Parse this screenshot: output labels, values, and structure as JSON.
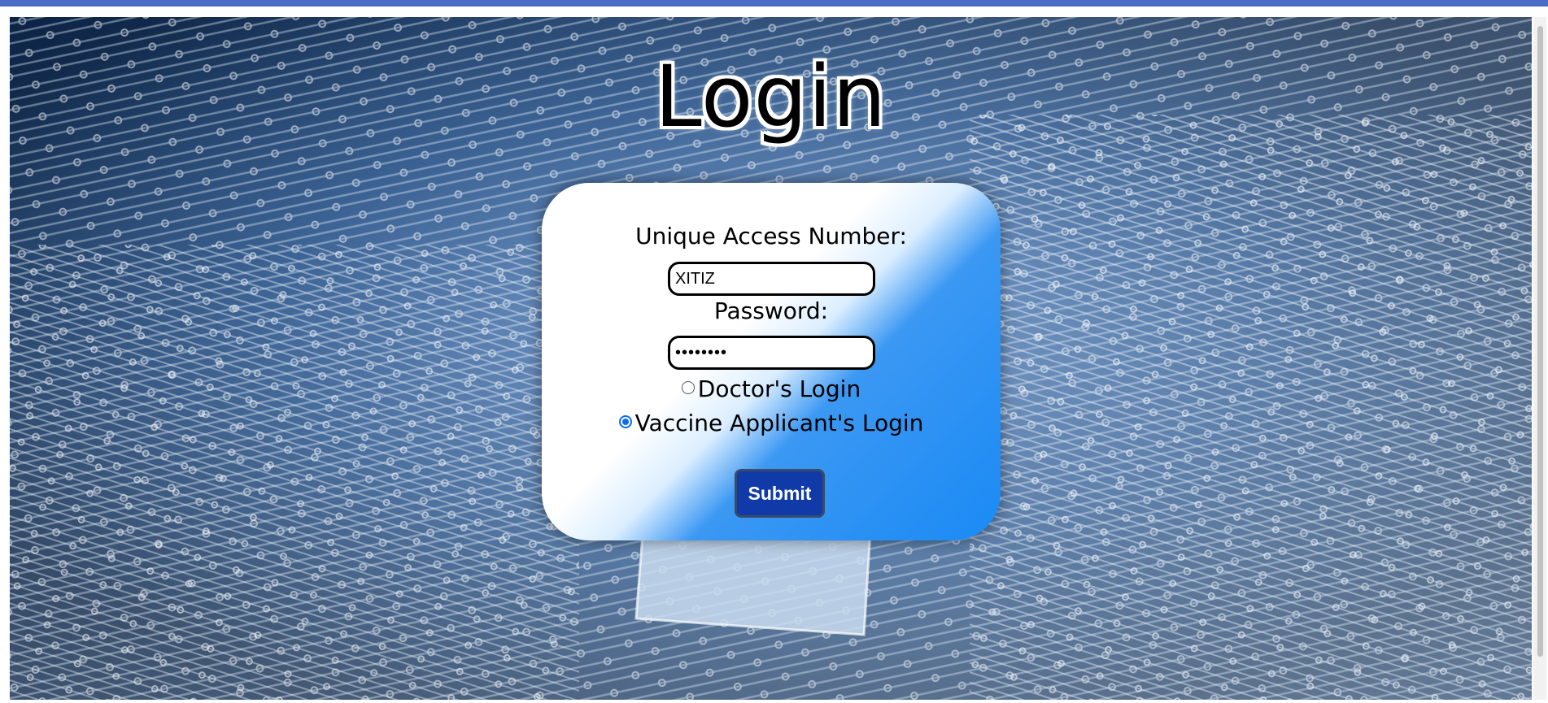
{
  "page": {
    "title": "Login"
  },
  "form": {
    "uan_label": "Unique Access Number:",
    "uan_value": "XITIZ",
    "password_label": "Password:",
    "password_value": "••••••••",
    "radio_options": [
      {
        "label": "Doctor's Login",
        "checked": false
      },
      {
        "label": "Vaccine Applicant's Login",
        "checked": true
      }
    ],
    "submit_label": "Submit"
  },
  "colors": {
    "topbar": "#4a6cc6",
    "accent": "#1a8af5",
    "submit_bg": "#0f3aa8",
    "radio_checked": "#0b6cf0"
  },
  "background": {
    "description_icon": "circuit-board-image"
  }
}
